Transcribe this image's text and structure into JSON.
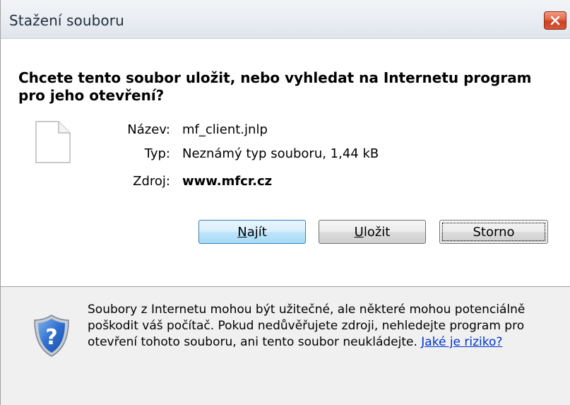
{
  "window": {
    "title": "Stažení souboru",
    "close_icon": "close-icon"
  },
  "dialog": {
    "question": "Chcete tento soubor uložit, nebo vyhledat na Internetu program pro jeho otevření?",
    "file": {
      "icon": "file-icon",
      "name_label": "Název:",
      "name_value": "mf_client.jnlp",
      "type_label": "Typ:",
      "type_value": "Neznámý typ souboru, 1,44 kB",
      "source_label": "Zdroj:",
      "source_value": "www.mfcr.cz"
    },
    "buttons": {
      "find": {
        "mnemonic": "N",
        "rest": "ajít"
      },
      "save": {
        "mnemonic": "U",
        "rest": "ložit"
      },
      "cancel": {
        "label": "Storno"
      }
    }
  },
  "warning": {
    "icon": "shield-question-icon",
    "text": "Soubory z Internetu mohou být užitečné, ale některé mohou potenciálně poškodit váš počítač. Pokud nedůvěřujete zdroji, nehledejte program pro otevření tohoto souboru, ani tento soubor neukládejte. ",
    "link": "Jaké je riziko?"
  },
  "colors": {
    "link": "#0033cc",
    "panel": "#f0f0f0",
    "close": "#d4583a"
  }
}
